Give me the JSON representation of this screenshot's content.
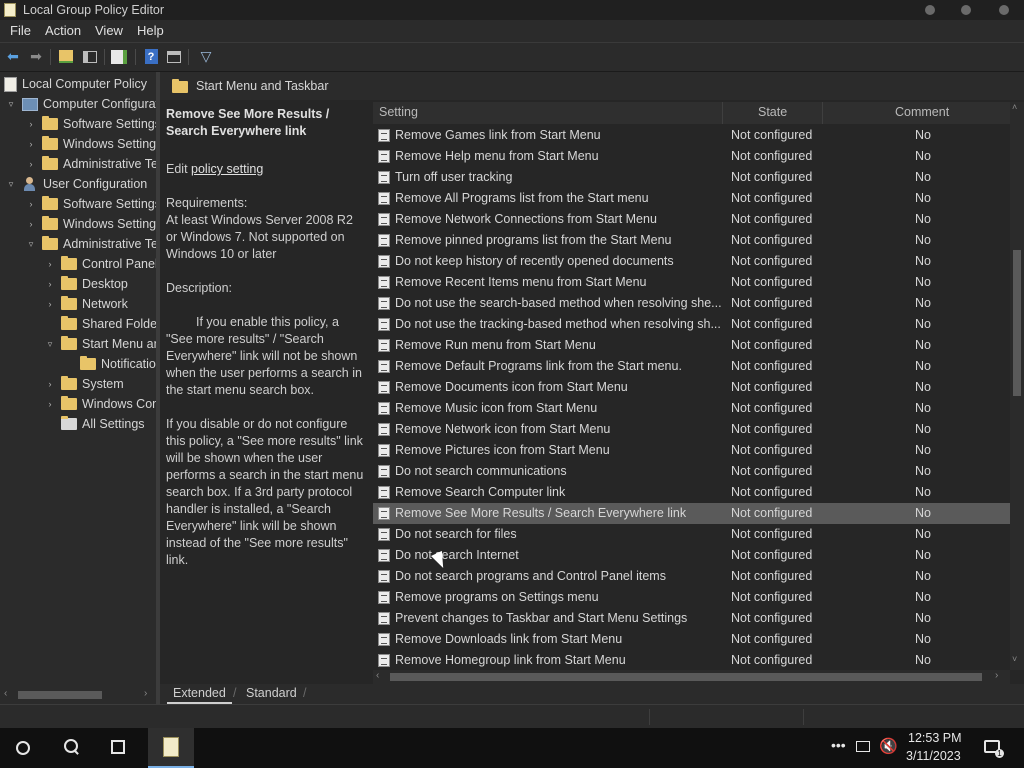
{
  "window": {
    "title": "Local Group Policy Editor",
    "app_icon": "gpedit-icon"
  },
  "menu": [
    "File",
    "Action",
    "View",
    "Help"
  ],
  "toolbar": {
    "icons": [
      "back-arrow-icon",
      "forward-arrow-icon",
      "up-folder-icon",
      "show-hide-tree-icon",
      "export-list-icon",
      "help-icon",
      "properties-icon",
      "filter-icon"
    ]
  },
  "tree": {
    "root": "Local Computer Policy",
    "computer": "Computer Configuration",
    "computer_children": [
      "Software Settings",
      "Windows Settings",
      "Administrative Templates"
    ],
    "user": "User Configuration",
    "user_children": [
      "Software Settings",
      "Windows Settings",
      "Administrative Templates"
    ],
    "admin_children": [
      "Control Panel",
      "Desktop",
      "Network",
      "Shared Folders",
      "Start Menu and Taskbar"
    ],
    "start_menu_children": [
      "Notifications"
    ],
    "after_start_menu": [
      "System",
      "Windows Components",
      "All Settings"
    ]
  },
  "header": {
    "path": "Start Menu and Taskbar"
  },
  "description": {
    "title": "Remove See More Results / Search Everywhere link",
    "edit_prefix": "Edit ",
    "edit_link": "policy setting ",
    "requirements_label": "Requirements:",
    "requirements": "At least Windows Server 2008 R2 or Windows 7. Not supported on Windows 10 or later",
    "description_label": "Description:",
    "para1": "If you enable this policy, a \"See more results\" / \"Search Everywhere\" link will not be shown when the user performs a search in the start menu search box.",
    "para2": "If you disable or do not configure this policy, a \"See more results\" link will be shown when the user performs a search in the start menu search box.  If a 3rd party protocol handler is installed, a \"Search Everywhere\" link will be shown instead of the \"See more results\" link."
  },
  "columns": {
    "setting": "Setting",
    "state": "State",
    "comment": "Comment"
  },
  "rows": [
    {
      "name": "Remove Games link from Start Menu",
      "state": "Not configured",
      "comment": "No"
    },
    {
      "name": "Remove Help menu from Start Menu",
      "state": "Not configured",
      "comment": "No"
    },
    {
      "name": "Turn off user tracking",
      "state": "Not configured",
      "comment": "No"
    },
    {
      "name": "Remove All Programs list from the Start menu",
      "state": "Not configured",
      "comment": "No"
    },
    {
      "name": "Remove Network Connections from Start Menu",
      "state": "Not configured",
      "comment": "No"
    },
    {
      "name": "Remove pinned programs list from the Start Menu",
      "state": "Not configured",
      "comment": "No"
    },
    {
      "name": "Do not keep history of recently opened documents",
      "state": "Not configured",
      "comment": "No"
    },
    {
      "name": "Remove Recent Items menu from Start Menu",
      "state": "Not configured",
      "comment": "No"
    },
    {
      "name": "Do not use the search-based method when resolving she...",
      "state": "Not configured",
      "comment": "No"
    },
    {
      "name": "Do not use the tracking-based method when resolving sh...",
      "state": "Not configured",
      "comment": "No"
    },
    {
      "name": "Remove Run menu from Start Menu",
      "state": "Not configured",
      "comment": "No"
    },
    {
      "name": "Remove Default Programs link from the Start menu.",
      "state": "Not configured",
      "comment": "No"
    },
    {
      "name": "Remove Documents icon from Start Menu",
      "state": "Not configured",
      "comment": "No"
    },
    {
      "name": "Remove Music icon from Start Menu",
      "state": "Not configured",
      "comment": "No"
    },
    {
      "name": "Remove Network icon from Start Menu",
      "state": "Not configured",
      "comment": "No"
    },
    {
      "name": "Remove Pictures icon from Start Menu",
      "state": "Not configured",
      "comment": "No"
    },
    {
      "name": "Do not search communications",
      "state": "Not configured",
      "comment": "No"
    },
    {
      "name": "Remove Search Computer link",
      "state": "Not configured",
      "comment": "No"
    },
    {
      "name": "Remove See More Results / Search Everywhere link",
      "state": "Not configured",
      "comment": "No",
      "selected": true
    },
    {
      "name": "Do not search for files",
      "state": "Not configured",
      "comment": "No"
    },
    {
      "name": "Do not search Internet",
      "state": "Not configured",
      "comment": "No"
    },
    {
      "name": "Do not search programs and Control Panel items",
      "state": "Not configured",
      "comment": "No"
    },
    {
      "name": "Remove programs on Settings menu",
      "state": "Not configured",
      "comment": "No"
    },
    {
      "name": "Prevent changes to Taskbar and Start Menu Settings",
      "state": "Not configured",
      "comment": "No"
    },
    {
      "name": "Remove Downloads link from Start Menu",
      "state": "Not configured",
      "comment": "No"
    },
    {
      "name": "Remove Homegroup link from Start Menu",
      "state": "Not configured",
      "comment": "No"
    }
  ],
  "tabs": [
    "Extended",
    "Standard"
  ],
  "taskbar": {
    "time": "12:53 PM",
    "date": "3/11/2023",
    "icons": [
      "start-icon",
      "search-icon",
      "task-view-icon",
      "gpedit-task-icon",
      "overflow-icon",
      "network-icon",
      "volume-muted-icon",
      "notifications-icon"
    ]
  }
}
